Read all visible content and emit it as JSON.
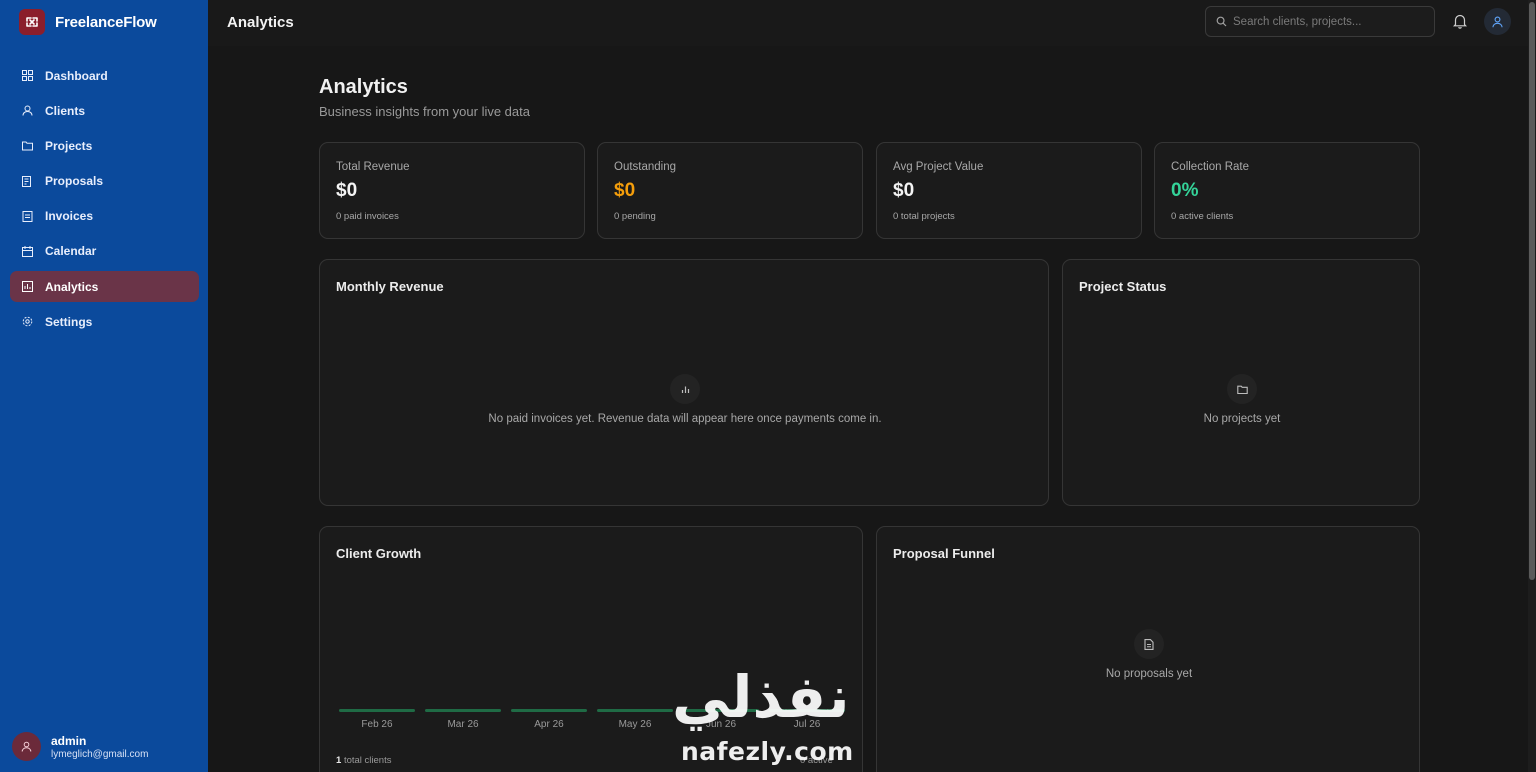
{
  "app": {
    "name": "FreelanceFlow",
    "brand_color": "#8b1e2b",
    "sidebar_color": "#0b4a9c"
  },
  "sidebar": {
    "items": [
      {
        "label": "Dashboard",
        "icon": "grid-icon"
      },
      {
        "label": "Clients",
        "icon": "user-icon"
      },
      {
        "label": "Projects",
        "icon": "folder-icon"
      },
      {
        "label": "Proposals",
        "icon": "document-list-icon"
      },
      {
        "label": "Invoices",
        "icon": "invoice-icon"
      },
      {
        "label": "Calendar",
        "icon": "calendar-icon"
      },
      {
        "label": "Analytics",
        "icon": "chart-icon",
        "active": true
      },
      {
        "label": "Settings",
        "icon": "gear-icon"
      }
    ],
    "user": {
      "name": "admin",
      "email": "lymeglich@gmail.com"
    }
  },
  "topbar": {
    "title": "Analytics",
    "search_placeholder": "Search clients, projects...",
    "notification_icon": "bell-icon",
    "profile_icon": "user-icon"
  },
  "page": {
    "title": "Analytics",
    "subtitle": "Business insights from your live data"
  },
  "stats": [
    {
      "label": "Total Revenue",
      "value": "$0",
      "sub": "0 paid invoices",
      "color": "#f4f4f4"
    },
    {
      "label": "Outstanding",
      "value": "$0",
      "sub": "0 pending",
      "color": "#f59e0b"
    },
    {
      "label": "Avg Project Value",
      "value": "$0",
      "sub": "0 total projects",
      "color": "#f4f4f4"
    },
    {
      "label": "Collection Rate",
      "value": "0%",
      "sub": "0 active clients",
      "color": "#34d399"
    }
  ],
  "panels": {
    "monthly_revenue": {
      "title": "Monthly Revenue",
      "empty": "No paid invoices yet. Revenue data will appear here once payments come in.",
      "icon": "bar-chart-icon"
    },
    "project_status": {
      "title": "Project Status",
      "empty": "No projects yet",
      "icon": "folder-icon"
    },
    "client_growth": {
      "title": "Client Growth",
      "months": [
        "Feb 26",
        "Mar 26",
        "Apr 26",
        "May 26",
        "Jun 26",
        "Jul 26"
      ],
      "counts": [
        0,
        0,
        0,
        0,
        0,
        0
      ],
      "total_count": "1",
      "total_label": "total clients",
      "right_label": "0 active"
    },
    "proposal_funnel": {
      "title": "Proposal Funnel",
      "empty": "No proposals yet",
      "icon": "document-icon"
    }
  },
  "watermark": {
    "arabic": "نفذلي",
    "latin": "nafezly.com"
  }
}
